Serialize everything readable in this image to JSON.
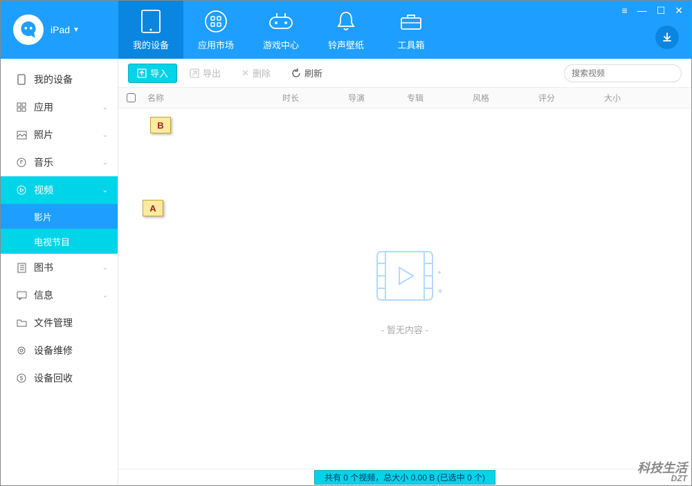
{
  "header": {
    "device_label": "iPad",
    "tabs": [
      {
        "label": "我的设备",
        "icon": "tablet"
      },
      {
        "label": "应用市场",
        "icon": "apps"
      },
      {
        "label": "游戏中心",
        "icon": "gamepad"
      },
      {
        "label": "铃声壁纸",
        "icon": "bell"
      },
      {
        "label": "工具箱",
        "icon": "toolbox"
      }
    ]
  },
  "sidebar": {
    "items": [
      {
        "label": "我的设备"
      },
      {
        "label": "应用"
      },
      {
        "label": "照片"
      },
      {
        "label": "音乐"
      },
      {
        "label": "视频"
      },
      {
        "label": "图书"
      },
      {
        "label": "信息"
      },
      {
        "label": "文件管理"
      },
      {
        "label": "设备维修"
      },
      {
        "label": "设备回收"
      }
    ],
    "video_sub": [
      {
        "label": "影片"
      },
      {
        "label": "电视节目"
      }
    ]
  },
  "toolbar": {
    "import_label": "导入",
    "export_label": "导出",
    "delete_label": "删除",
    "refresh_label": "刷新",
    "search_placeholder": "搜索视频"
  },
  "columns": {
    "name": "名称",
    "duration": "时长",
    "director": "导演",
    "album": "专辑",
    "style": "风格",
    "rating": "评分",
    "size": "大小"
  },
  "empty": {
    "text": "- 暂无内容 -"
  },
  "callouts": {
    "a": "A",
    "b": "B"
  },
  "status": {
    "text": "共有 0 个视频，总大小 0.00 B (已选中 0 个)"
  },
  "watermark": {
    "top": "科技生活",
    "bottom": "DZT"
  }
}
